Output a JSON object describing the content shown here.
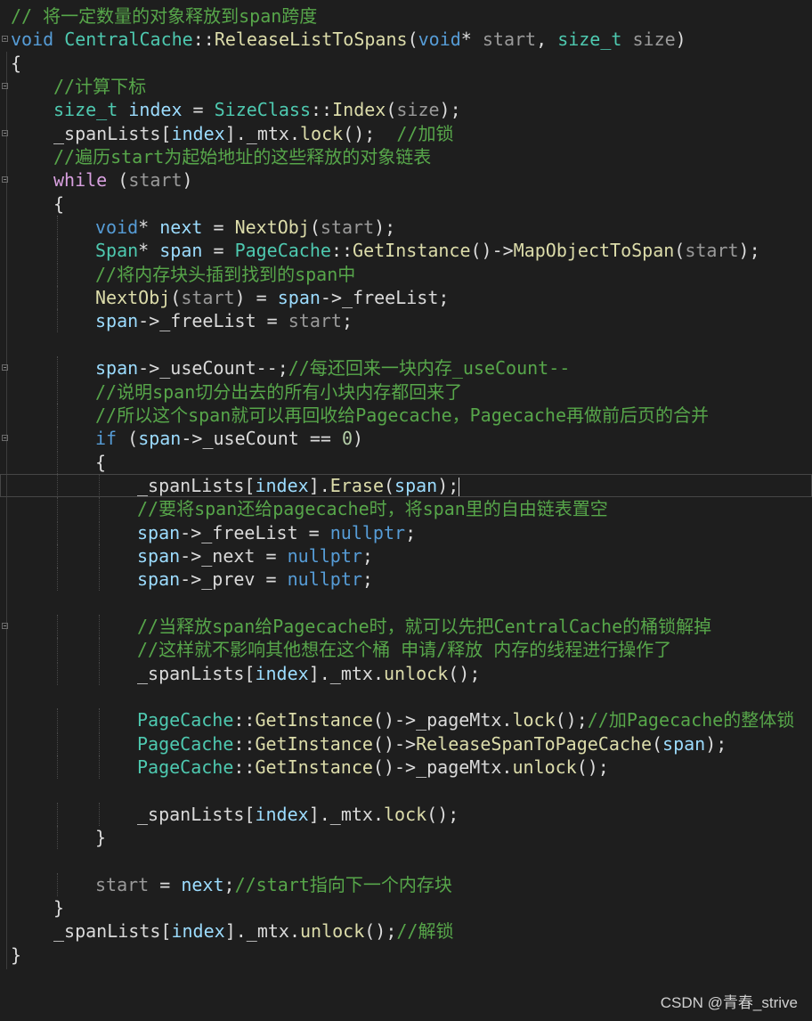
{
  "colors": {
    "background": "#1e1e1e",
    "comment": "#57a64a",
    "keyword": "#569cd6",
    "type": "#4ec9b0",
    "function": "#dcdcaa",
    "variable": "#9cdcfe",
    "plain": "#dcdcdc",
    "parameter": "#9a9a9a"
  },
  "editor": {
    "current_line_index": 20,
    "lines": [
      {
        "indent": 0,
        "fold": false,
        "tokens": [
          {
            "t": "// 将一定数量的对象释放到span跨度",
            "c": "cm"
          }
        ]
      },
      {
        "indent": 0,
        "fold": true,
        "tokens": [
          {
            "t": "void",
            "c": "kw"
          },
          {
            "t": " ",
            "c": "pl"
          },
          {
            "t": "CentralCache",
            "c": "ty"
          },
          {
            "t": "::",
            "c": "pl"
          },
          {
            "t": "ReleaseListToSpans",
            "c": "fn"
          },
          {
            "t": "(",
            "c": "pl"
          },
          {
            "t": "void",
            "c": "kw"
          },
          {
            "t": "* ",
            "c": "pl"
          },
          {
            "t": "start",
            "c": "pm"
          },
          {
            "t": ", ",
            "c": "pl"
          },
          {
            "t": "size_t",
            "c": "ty"
          },
          {
            "t": " ",
            "c": "pl"
          },
          {
            "t": "size",
            "c": "pm"
          },
          {
            "t": ")",
            "c": "pl"
          }
        ]
      },
      {
        "indent": 0,
        "fold": false,
        "tokens": [
          {
            "t": "{",
            "c": "pl"
          }
        ]
      },
      {
        "indent": 1,
        "fold": true,
        "tokens": [
          {
            "t": "//计算下标",
            "c": "cm"
          }
        ]
      },
      {
        "indent": 1,
        "fold": false,
        "tokens": [
          {
            "t": "size_t",
            "c": "ty"
          },
          {
            "t": " ",
            "c": "pl"
          },
          {
            "t": "index",
            "c": "id"
          },
          {
            "t": " = ",
            "c": "pl"
          },
          {
            "t": "SizeClass",
            "c": "ty"
          },
          {
            "t": "::",
            "c": "pl"
          },
          {
            "t": "Index",
            "c": "fn"
          },
          {
            "t": "(",
            "c": "pl"
          },
          {
            "t": "size",
            "c": "pm"
          },
          {
            "t": ");",
            "c": "pl"
          }
        ]
      },
      {
        "indent": 1,
        "fold": true,
        "tokens": [
          {
            "t": "_spanLists",
            "c": "mc"
          },
          {
            "t": "[",
            "c": "pl"
          },
          {
            "t": "index",
            "c": "id"
          },
          {
            "t": "].",
            "c": "pl"
          },
          {
            "t": "_mtx",
            "c": "mc"
          },
          {
            "t": ".",
            "c": "pl"
          },
          {
            "t": "lock",
            "c": "fn"
          },
          {
            "t": "();  ",
            "c": "pl"
          },
          {
            "t": "//加锁",
            "c": "cm"
          }
        ]
      },
      {
        "indent": 1,
        "fold": false,
        "tokens": [
          {
            "t": "//遍历start为起始地址的这些释放的对象链表",
            "c": "cm"
          }
        ]
      },
      {
        "indent": 1,
        "fold": true,
        "tokens": [
          {
            "t": "while",
            "c": "wh"
          },
          {
            "t": " (",
            "c": "pl"
          },
          {
            "t": "start",
            "c": "pm"
          },
          {
            "t": ")",
            "c": "pl"
          }
        ]
      },
      {
        "indent": 1,
        "fold": false,
        "tokens": [
          {
            "t": "{",
            "c": "pl"
          }
        ]
      },
      {
        "indent": 2,
        "fold": false,
        "tokens": [
          {
            "t": "void",
            "c": "kw"
          },
          {
            "t": "* ",
            "c": "pl"
          },
          {
            "t": "next",
            "c": "id"
          },
          {
            "t": " = ",
            "c": "pl"
          },
          {
            "t": "NextObj",
            "c": "fn"
          },
          {
            "t": "(",
            "c": "pl"
          },
          {
            "t": "start",
            "c": "pm"
          },
          {
            "t": ");",
            "c": "pl"
          }
        ]
      },
      {
        "indent": 2,
        "fold": false,
        "tokens": [
          {
            "t": "Span",
            "c": "ty"
          },
          {
            "t": "* ",
            "c": "pl"
          },
          {
            "t": "span",
            "c": "id"
          },
          {
            "t": " = ",
            "c": "pl"
          },
          {
            "t": "PageCache",
            "c": "ty"
          },
          {
            "t": "::",
            "c": "pl"
          },
          {
            "t": "GetInstance",
            "c": "fn"
          },
          {
            "t": "()->",
            "c": "pl"
          },
          {
            "t": "MapObjectToSpan",
            "c": "fn"
          },
          {
            "t": "(",
            "c": "pl"
          },
          {
            "t": "start",
            "c": "pm"
          },
          {
            "t": ");",
            "c": "pl"
          }
        ]
      },
      {
        "indent": 2,
        "fold": false,
        "tokens": [
          {
            "t": "//将内存块头插到找到的span中",
            "c": "cm"
          }
        ]
      },
      {
        "indent": 2,
        "fold": false,
        "tokens": [
          {
            "t": "NextObj",
            "c": "fn"
          },
          {
            "t": "(",
            "c": "pl"
          },
          {
            "t": "start",
            "c": "pm"
          },
          {
            "t": ") = ",
            "c": "pl"
          },
          {
            "t": "span",
            "c": "id"
          },
          {
            "t": "->",
            "c": "pl"
          },
          {
            "t": "_freeList",
            "c": "mc"
          },
          {
            "t": ";",
            "c": "pl"
          }
        ]
      },
      {
        "indent": 2,
        "fold": false,
        "tokens": [
          {
            "t": "span",
            "c": "id"
          },
          {
            "t": "->",
            "c": "pl"
          },
          {
            "t": "_freeList",
            "c": "mc"
          },
          {
            "t": " = ",
            "c": "pl"
          },
          {
            "t": "start",
            "c": "pm"
          },
          {
            "t": ";",
            "c": "pl"
          }
        ]
      },
      {
        "indent": 0,
        "fold": false,
        "tokens": []
      },
      {
        "indent": 2,
        "fold": true,
        "tokens": [
          {
            "t": "span",
            "c": "id"
          },
          {
            "t": "->",
            "c": "pl"
          },
          {
            "t": "_useCount",
            "c": "mc"
          },
          {
            "t": "--;",
            "c": "pl"
          },
          {
            "t": "//每还回来一块内存_useCount--",
            "c": "cm"
          }
        ]
      },
      {
        "indent": 2,
        "fold": false,
        "tokens": [
          {
            "t": "//说明span切分出去的所有小块内存都回来了",
            "c": "cm"
          }
        ]
      },
      {
        "indent": 2,
        "fold": false,
        "tokens": [
          {
            "t": "//所以这个span就可以再回收给Pagecache，Pagecache再做前后页的合并",
            "c": "cm"
          }
        ]
      },
      {
        "indent": 2,
        "fold": true,
        "tokens": [
          {
            "t": "if",
            "c": "kw"
          },
          {
            "t": " (",
            "c": "pl"
          },
          {
            "t": "span",
            "c": "id"
          },
          {
            "t": "->",
            "c": "pl"
          },
          {
            "t": "_useCount",
            "c": "mc"
          },
          {
            "t": " == ",
            "c": "pl"
          },
          {
            "t": "0",
            "c": "nm"
          },
          {
            "t": ")",
            "c": "pl"
          }
        ]
      },
      {
        "indent": 2,
        "fold": false,
        "tokens": [
          {
            "t": "{",
            "c": "pl"
          }
        ]
      },
      {
        "indent": 3,
        "fold": false,
        "tokens": [
          {
            "t": "_spanLists",
            "c": "mc"
          },
          {
            "t": "[",
            "c": "pl"
          },
          {
            "t": "index",
            "c": "id"
          },
          {
            "t": "].",
            "c": "pl"
          },
          {
            "t": "Erase",
            "c": "fn"
          },
          {
            "t": "(",
            "c": "pl"
          },
          {
            "t": "span",
            "c": "id"
          },
          {
            "t": ");",
            "c": "pl"
          }
        ]
      },
      {
        "indent": 3,
        "fold": false,
        "tokens": [
          {
            "t": "//要将span还给pagecache时，将span里的自由链表置空",
            "c": "cm"
          }
        ]
      },
      {
        "indent": 3,
        "fold": false,
        "tokens": [
          {
            "t": "span",
            "c": "id"
          },
          {
            "t": "->",
            "c": "pl"
          },
          {
            "t": "_freeList",
            "c": "mc"
          },
          {
            "t": " = ",
            "c": "pl"
          },
          {
            "t": "nullptr",
            "c": "kw"
          },
          {
            "t": ";",
            "c": "pl"
          }
        ]
      },
      {
        "indent": 3,
        "fold": false,
        "tokens": [
          {
            "t": "span",
            "c": "id"
          },
          {
            "t": "->",
            "c": "pl"
          },
          {
            "t": "_next",
            "c": "mc"
          },
          {
            "t": " = ",
            "c": "pl"
          },
          {
            "t": "nullptr",
            "c": "kw"
          },
          {
            "t": ";",
            "c": "pl"
          }
        ]
      },
      {
        "indent": 3,
        "fold": false,
        "tokens": [
          {
            "t": "span",
            "c": "id"
          },
          {
            "t": "->",
            "c": "pl"
          },
          {
            "t": "_prev",
            "c": "mc"
          },
          {
            "t": " = ",
            "c": "pl"
          },
          {
            "t": "nullptr",
            "c": "kw"
          },
          {
            "t": ";",
            "c": "pl"
          }
        ]
      },
      {
        "indent": 0,
        "fold": false,
        "tokens": []
      },
      {
        "indent": 3,
        "fold": true,
        "tokens": [
          {
            "t": "//当释放span给Pagecache时，就可以先把CentralCache的桶锁解掉",
            "c": "cm"
          }
        ]
      },
      {
        "indent": 3,
        "fold": false,
        "tokens": [
          {
            "t": "//这样就不影响其他想在这个桶 申请/释放 内存的线程进行操作了",
            "c": "cm"
          }
        ]
      },
      {
        "indent": 3,
        "fold": false,
        "tokens": [
          {
            "t": "_spanLists",
            "c": "mc"
          },
          {
            "t": "[",
            "c": "pl"
          },
          {
            "t": "index",
            "c": "id"
          },
          {
            "t": "].",
            "c": "pl"
          },
          {
            "t": "_mtx",
            "c": "mc"
          },
          {
            "t": ".",
            "c": "pl"
          },
          {
            "t": "unlock",
            "c": "fn"
          },
          {
            "t": "();",
            "c": "pl"
          }
        ]
      },
      {
        "indent": 0,
        "fold": false,
        "tokens": []
      },
      {
        "indent": 3,
        "fold": false,
        "tokens": [
          {
            "t": "PageCache",
            "c": "ty"
          },
          {
            "t": "::",
            "c": "pl"
          },
          {
            "t": "GetInstance",
            "c": "fn"
          },
          {
            "t": "()->",
            "c": "pl"
          },
          {
            "t": "_pageMtx",
            "c": "mc"
          },
          {
            "t": ".",
            "c": "pl"
          },
          {
            "t": "lock",
            "c": "fn"
          },
          {
            "t": "();",
            "c": "pl"
          },
          {
            "t": "//加Pagecache的整体锁",
            "c": "cm"
          }
        ]
      },
      {
        "indent": 3,
        "fold": false,
        "tokens": [
          {
            "t": "PageCache",
            "c": "ty"
          },
          {
            "t": "::",
            "c": "pl"
          },
          {
            "t": "GetInstance",
            "c": "fn"
          },
          {
            "t": "()->",
            "c": "pl"
          },
          {
            "t": "ReleaseSpanToPageCache",
            "c": "fn"
          },
          {
            "t": "(",
            "c": "pl"
          },
          {
            "t": "span",
            "c": "id"
          },
          {
            "t": ");",
            "c": "pl"
          }
        ]
      },
      {
        "indent": 3,
        "fold": false,
        "tokens": [
          {
            "t": "PageCache",
            "c": "ty"
          },
          {
            "t": "::",
            "c": "pl"
          },
          {
            "t": "GetInstance",
            "c": "fn"
          },
          {
            "t": "()->",
            "c": "pl"
          },
          {
            "t": "_pageMtx",
            "c": "mc"
          },
          {
            "t": ".",
            "c": "pl"
          },
          {
            "t": "unlock",
            "c": "fn"
          },
          {
            "t": "();",
            "c": "pl"
          }
        ]
      },
      {
        "indent": 0,
        "fold": false,
        "tokens": []
      },
      {
        "indent": 3,
        "fold": false,
        "tokens": [
          {
            "t": "_spanLists",
            "c": "mc"
          },
          {
            "t": "[",
            "c": "pl"
          },
          {
            "t": "index",
            "c": "id"
          },
          {
            "t": "].",
            "c": "pl"
          },
          {
            "t": "_mtx",
            "c": "mc"
          },
          {
            "t": ".",
            "c": "pl"
          },
          {
            "t": "lock",
            "c": "fn"
          },
          {
            "t": "();",
            "c": "pl"
          }
        ]
      },
      {
        "indent": 2,
        "fold": false,
        "tokens": [
          {
            "t": "}",
            "c": "pl"
          }
        ]
      },
      {
        "indent": 0,
        "fold": false,
        "tokens": []
      },
      {
        "indent": 2,
        "fold": false,
        "tokens": [
          {
            "t": "start",
            "c": "pm"
          },
          {
            "t": " = ",
            "c": "pl"
          },
          {
            "t": "next",
            "c": "id"
          },
          {
            "t": ";",
            "c": "pl"
          },
          {
            "t": "//start指向下一个内存块",
            "c": "cm"
          }
        ]
      },
      {
        "indent": 1,
        "fold": false,
        "tokens": [
          {
            "t": "}",
            "c": "pl"
          }
        ]
      },
      {
        "indent": 1,
        "fold": false,
        "tokens": [
          {
            "t": "_spanLists",
            "c": "mc"
          },
          {
            "t": "[",
            "c": "pl"
          },
          {
            "t": "index",
            "c": "id"
          },
          {
            "t": "].",
            "c": "pl"
          },
          {
            "t": "_mtx",
            "c": "mc"
          },
          {
            "t": ".",
            "c": "pl"
          },
          {
            "t": "unlock",
            "c": "fn"
          },
          {
            "t": "();",
            "c": "pl"
          },
          {
            "t": "//解锁",
            "c": "cm"
          }
        ]
      },
      {
        "indent": 0,
        "fold": false,
        "tokens": [
          {
            "t": "}",
            "c": "pl"
          }
        ]
      }
    ]
  },
  "watermark": "CSDN @青春_strive"
}
